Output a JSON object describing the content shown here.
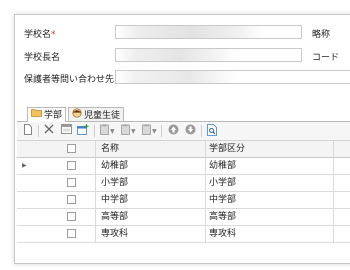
{
  "form": {
    "school_name_label": "学校名",
    "required_mark": "*",
    "abbr_label": "略称",
    "principal_label": "学校長名",
    "code_label": "コード",
    "guardian_contact_label": "保護者等問い合わせ先"
  },
  "tabs": [
    {
      "label": "学部",
      "icon": "folder-icon",
      "active": true
    },
    {
      "label": "児童生徒",
      "icon": "student-icon",
      "active": false
    }
  ],
  "toolbar": {
    "buttons": [
      "new-doc-icon",
      "delete-icon",
      "window-icon",
      "add-row-icon",
      "clipboard-icon",
      "clipboard-icon",
      "clipboard-icon",
      "arrow-up-icon",
      "arrow-down-icon",
      "preview-icon"
    ]
  },
  "grid": {
    "columns": [
      "名称",
      "学部区分"
    ],
    "rows": [
      {
        "name": "幼稚部",
        "category": "幼稚部",
        "current": true
      },
      {
        "name": "小学部",
        "category": "小学部",
        "current": false
      },
      {
        "name": "中学部",
        "category": "中学部",
        "current": false
      },
      {
        "name": "高等部",
        "category": "高等部",
        "current": false
      },
      {
        "name": "専攻科",
        "category": "専攻科",
        "current": false
      }
    ]
  },
  "colors": {
    "required": "#e03030",
    "folder": "#e8a93a",
    "border": "#c9c9c9"
  }
}
